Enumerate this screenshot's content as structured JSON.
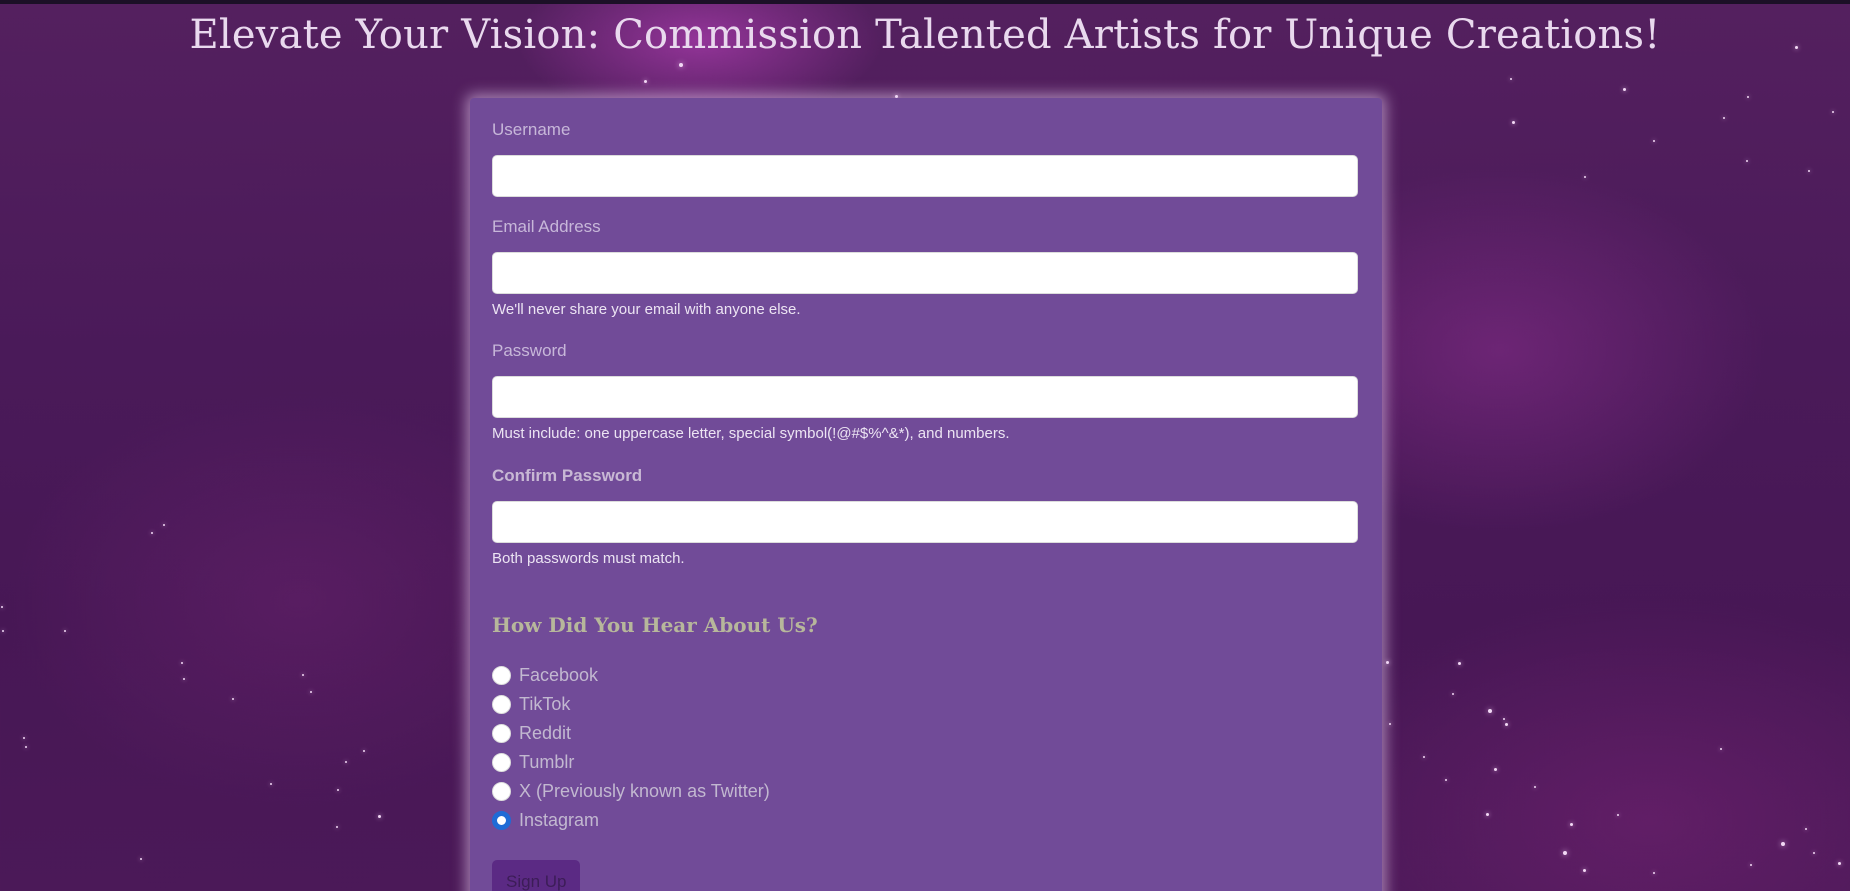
{
  "page": {
    "title": "Elevate Your Vision: Commission Talented Artists for Unique Creations!"
  },
  "form": {
    "username": {
      "label": "Username",
      "value": ""
    },
    "email": {
      "label": "Email Address",
      "value": "",
      "help": "We'll never share your email with anyone else."
    },
    "password": {
      "label": "Password",
      "value": "",
      "help": "Must include: one uppercase letter, special symbol(!@#$%^&*), and numbers."
    },
    "confirm_password": {
      "label": "Confirm Password",
      "value": "",
      "help": "Both passwords must match."
    },
    "referral": {
      "heading": "How Did You Hear About Us?",
      "options": [
        {
          "label": "Facebook",
          "checked": false
        },
        {
          "label": "TikTok",
          "checked": false
        },
        {
          "label": "Reddit",
          "checked": false
        },
        {
          "label": "Tumblr",
          "checked": false
        },
        {
          "label": "X (Previously known as Twitter)",
          "checked": false
        },
        {
          "label": "Instagram",
          "checked": true
        }
      ]
    },
    "submit_label": "Sign Up"
  },
  "colors": {
    "background": "#4a1a59",
    "card": "#714b98",
    "radio_checked": "#1f6bd6",
    "heading": "#b7b79b"
  }
}
